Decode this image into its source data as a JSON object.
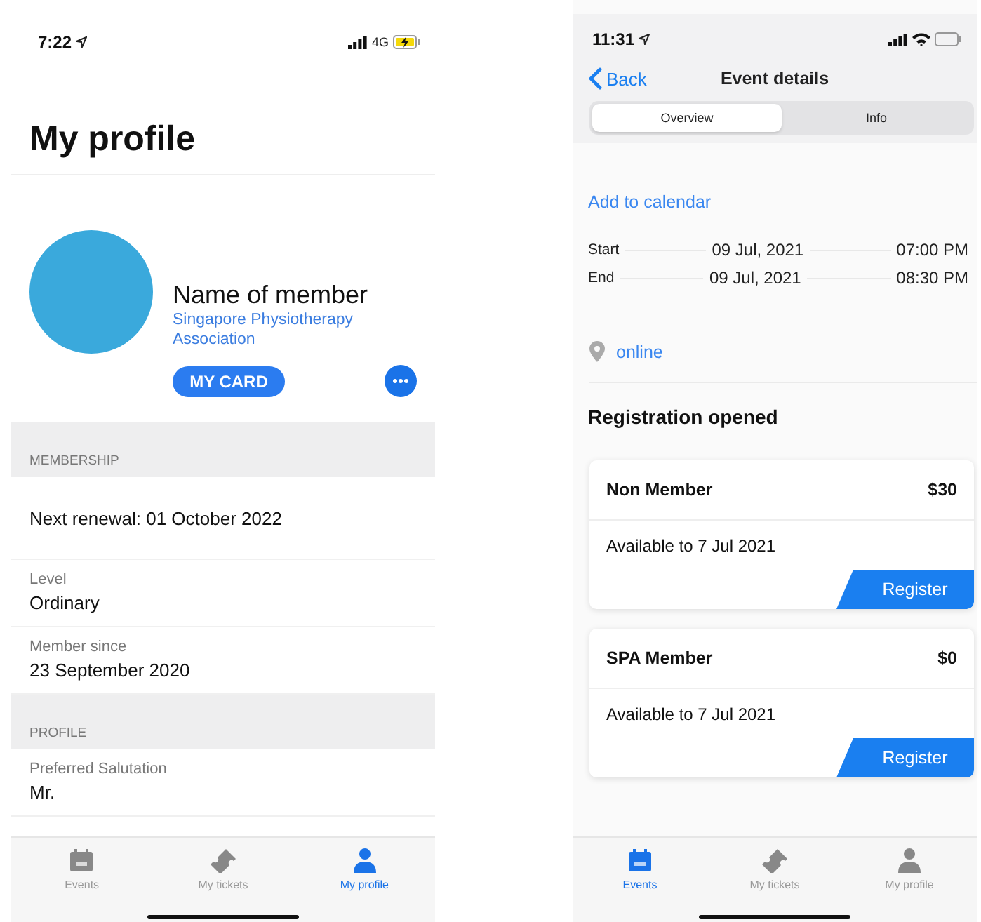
{
  "profile_screen": {
    "status_bar": {
      "time": "7:22",
      "network": "4G",
      "battery_charging": true
    },
    "title": "My profile",
    "member": {
      "name": "Name of member",
      "organisation": "Singapore Physiotherapy Association",
      "card_button": "MY CARD"
    },
    "sections": [
      {
        "header": "MEMBERSHIP",
        "rows": [
          {
            "kind": "single",
            "value": "Next renewal: 01 October 2022"
          },
          {
            "kind": "field",
            "label": "Level",
            "value": "Ordinary"
          },
          {
            "kind": "field",
            "label": "Member since",
            "value": "23 September 2020"
          }
        ]
      },
      {
        "header": "PROFILE",
        "rows": [
          {
            "kind": "field",
            "label": "Preferred Salutation",
            "value": "Mr."
          }
        ]
      }
    ],
    "tab_bar": [
      {
        "label": "Events",
        "selected": false
      },
      {
        "label": "My tickets",
        "selected": false
      },
      {
        "label": "My profile",
        "selected": true
      }
    ]
  },
  "event_screen": {
    "status_bar": {
      "time": "11:31",
      "battery_charging": false
    },
    "back": "Back",
    "title": "Event details",
    "segments": [
      {
        "label": "Overview",
        "selected": true
      },
      {
        "label": "Info",
        "selected": false
      }
    ],
    "calendar_link": "Add to calendar",
    "schedule": [
      {
        "label": "Start",
        "date": "09 Jul, 2021",
        "time": "07:00 PM"
      },
      {
        "label": "End",
        "date": "09 Jul, 2021",
        "time": "08:30 PM"
      }
    ],
    "location": "online",
    "registration_heading": "Registration opened",
    "tickets": [
      {
        "name": "Non Member",
        "price": "$30",
        "availability": "Available to 7 Jul 2021",
        "button": "Register"
      },
      {
        "name": "SPA Member",
        "price": "$0",
        "availability": "Available to 7 Jul 2021",
        "button": "Register"
      }
    ],
    "tab_bar": [
      {
        "label": "Events",
        "selected": true
      },
      {
        "label": "My tickets",
        "selected": false
      },
      {
        "label": "My profile",
        "selected": false
      }
    ]
  }
}
